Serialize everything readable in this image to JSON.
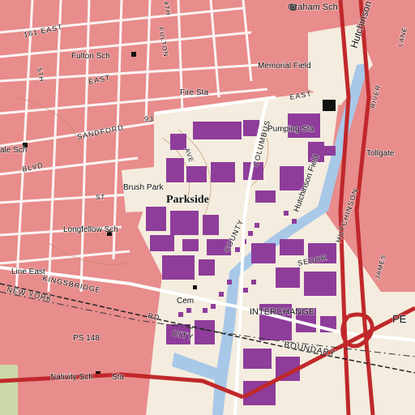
{
  "map": {
    "colors": {
      "urban": "#e88c8c",
      "urban_grid": "#c96a6a",
      "open": "#f4ecde",
      "building": "#8e3d9a",
      "water": "#a8c8e8",
      "highway": "#c0282b",
      "road": "#ffffff",
      "rail": "#222222",
      "contour": "#b98a5a",
      "park": "#ccd8a8"
    },
    "labels": {
      "graham_sch": "Graham Sch",
      "hutchinson_top": "Hutchinson",
      "fulton_sch": "Fulton Sch",
      "memorial_field": "Memorial Field",
      "fire_sta": "Fire Sta",
      "pumping_sta": "Pumping Sta",
      "tollgate": "Tollgate",
      "ale_sch": "ale Sch",
      "brush_park": "Brush Park",
      "parkside": "Parkside",
      "hutchinson_field": "Hutchinson Field",
      "longfellow_sch": "Longfellow Sch",
      "line_east": "Line East",
      "cem": "Cem",
      "interchange": "INTERCHANGE",
      "pe": "PE",
      "ps148": "PS 148",
      "nativity_sch": "Nativity Sch",
      "sta": "Sta"
    },
    "road_labels": {
      "east_161": "161 EAST",
      "east_top": "EAST",
      "fulton": "FULTON",
      "fifth": "5TH",
      "fourth": "4TH",
      "sandford": "SANDFORD",
      "blvd": "BLVD",
      "rt93": "93",
      "east_mid": "EAST",
      "kingsbridge": "KINGSBRIDGE",
      "rd": "RD",
      "new_york": "NEW YORK",
      "city": "CITY",
      "boundary": "BOUNDARY",
      "sedor": "SEDOR",
      "hutchinson_road": "HUTCHINSON",
      "columbus": "COLUMBUS",
      "county": "COUNTY",
      "ave": "AVE",
      "st": "ST",
      "james": "JAMES",
      "lane": "LANE",
      "river": "RIVER"
    }
  }
}
